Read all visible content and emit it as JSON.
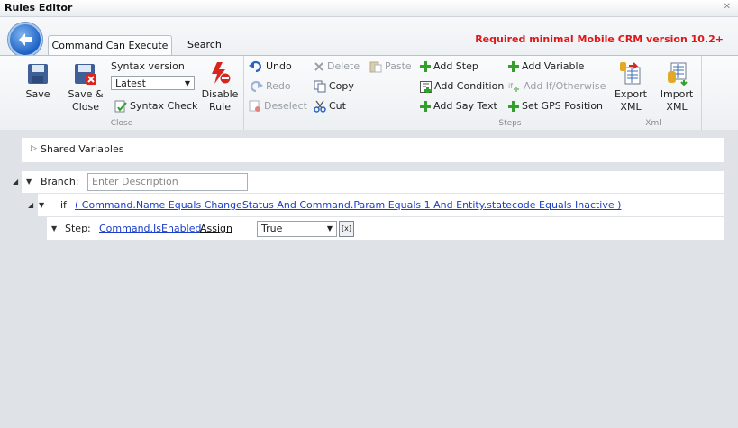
{
  "window": {
    "title": "Rules Editor",
    "close": "✕"
  },
  "tabs": [
    {
      "label": "Command Can Execute"
    },
    {
      "label": "Search"
    }
  ],
  "requirement": "Required minimal Mobile CRM version 10.2+",
  "ribbon": {
    "close_group": {
      "label": "Close",
      "save": "Save",
      "save_close": [
        "Save &",
        "Close"
      ],
      "syntax_version_label": "Syntax version",
      "syntax_version_value": "Latest",
      "syntax_check": "Syntax Check",
      "disable_rule": [
        "Disable",
        "Rule"
      ]
    },
    "edit_group": {
      "undo": "Undo",
      "redo": "Redo",
      "deselect": "Deselect",
      "delete": "Delete",
      "copy": "Copy",
      "cut": "Cut",
      "paste": "Paste"
    },
    "steps_group": {
      "label": "Steps",
      "add_step": "Add Step",
      "add_condition": "Add Condition",
      "add_say_text": "Add Say Text",
      "add_variable": "Add Variable",
      "add_if_otherwise": "Add If/Otherwise",
      "set_gps": "Set GPS Position"
    },
    "xml_group": {
      "label": "Xml",
      "export": [
        "Export",
        "XML"
      ],
      "import": [
        "Import",
        "XML"
      ]
    }
  },
  "editor": {
    "shared_variables": "Shared Variables",
    "branch_label": "Branch:",
    "branch_placeholder": "Enter Description",
    "if_label": "if",
    "condition": "( Command.Name Equals ChangeStatus And Command.Param Equals 1 And Entity.statecode Equals Inactive )",
    "step_label": "Step:",
    "step_target": "Command.IsEnabled",
    "step_action": "Assign",
    "step_value": "True",
    "step_expr_button": "[x]"
  },
  "colors": {
    "accent_red": "#e01717",
    "link_blue": "#1a3ecb"
  }
}
